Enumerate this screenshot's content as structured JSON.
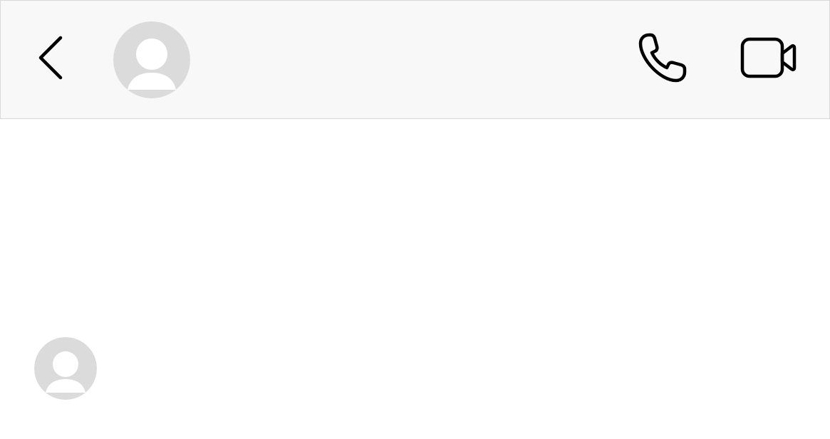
{
  "header": {
    "back_icon": "chevron-left-icon",
    "avatar_icon": "default-user-avatar",
    "actions": [
      {
        "name": "voice-call",
        "icon": "phone-icon"
      },
      {
        "name": "video-call",
        "icon": "video-camera-icon"
      }
    ]
  },
  "conversation": {
    "messages": [
      {
        "sender_avatar_icon": "default-user-avatar",
        "text": ""
      }
    ]
  },
  "colors": {
    "header_background": "#f8f8f8",
    "header_border": "#d9d9d9",
    "icon_stroke": "#000000",
    "avatar_background": "#dbdbdb",
    "avatar_figure": "#ffffff",
    "page_background": "#ffffff"
  }
}
